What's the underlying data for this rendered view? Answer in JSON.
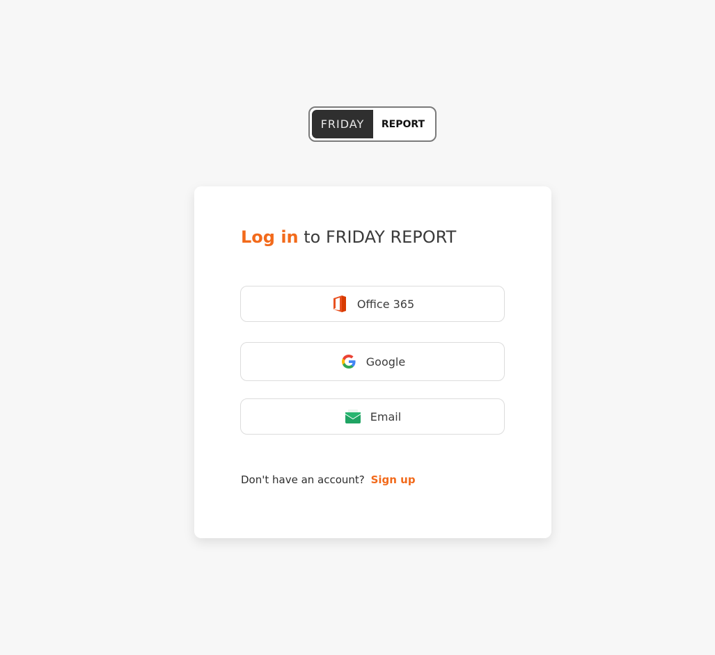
{
  "logo": {
    "left_text": "FRIDAY",
    "right_text": "REPORT"
  },
  "card": {
    "heading_accent": "Log in",
    "heading_rest": " to FRIDAY REPORT",
    "buttons": [
      {
        "label": "Office 365",
        "icon": "office-365-icon"
      },
      {
        "label": "Google",
        "icon": "google-icon"
      },
      {
        "label": "Email",
        "icon": "email-icon"
      }
    ],
    "signup_prompt": "Don't have an account?",
    "signup_link": "Sign up"
  },
  "colors": {
    "accent": "#f26a1b",
    "page_bg": "#f7f7f7",
    "card_bg": "#ffffff",
    "logo_dark": "#2f2f2f"
  }
}
